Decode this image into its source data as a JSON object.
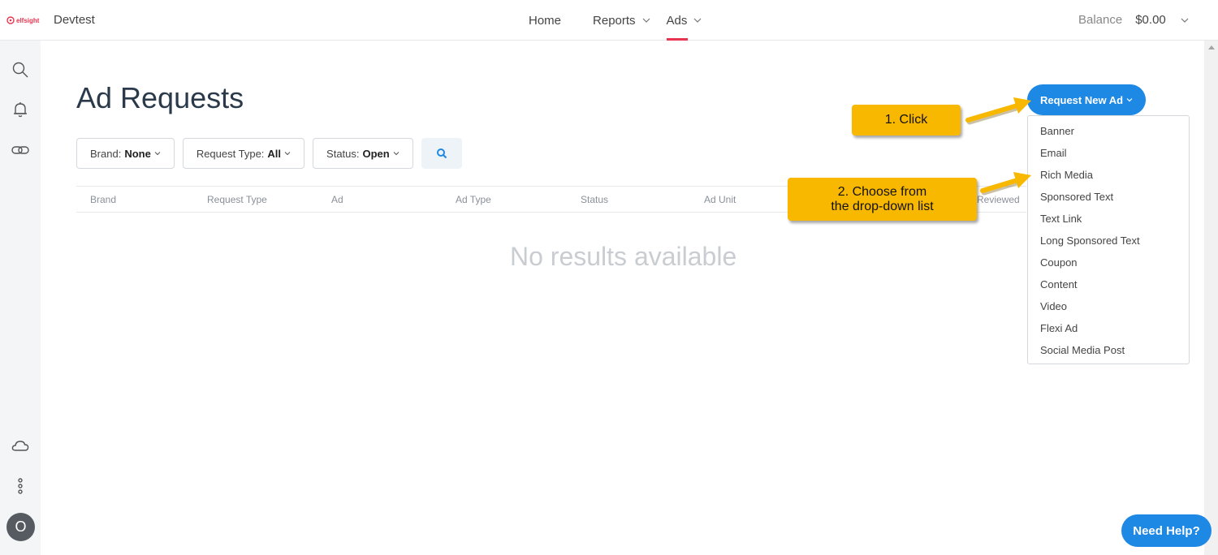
{
  "header": {
    "logo_text": "elfsight",
    "app_name": "Devtest",
    "nav": [
      {
        "label": "Home"
      },
      {
        "label": "Reports"
      },
      {
        "label": "Ads"
      }
    ],
    "balance_label": "Balance",
    "balance_amount": "$0.00"
  },
  "sidebar": {
    "icons": [
      "search-icon",
      "bell-icon",
      "link-icon",
      "cloud-icon",
      "more-vertical-icon"
    ],
    "avatar_initial": "O"
  },
  "main": {
    "title": "Ad Requests",
    "filters": [
      {
        "label": "Brand:",
        "value": "None"
      },
      {
        "label": "Request Type:",
        "value": "All"
      },
      {
        "label": "Status:",
        "value": "Open"
      }
    ],
    "columns": [
      "Brand",
      "Request Type",
      "Ad",
      "Ad Type",
      "Status",
      "Ad Unit",
      "Reviewed"
    ],
    "empty_text": "No results available"
  },
  "request_button": {
    "label": "Request New Ad",
    "options": [
      "Banner",
      "Email",
      "Rich Media",
      "Sponsored Text",
      "Text Link",
      "Long Sponsored Text",
      "Coupon",
      "Content",
      "Video",
      "Flexi Ad",
      "Social Media Post"
    ]
  },
  "callouts": {
    "first": "1. Click",
    "second_line1": "2. Choose from",
    "second_line2": "the drop-down list"
  },
  "help_button": "Need Help?",
  "colors": {
    "primary": "#1e88e5",
    "accent": "#e8344e",
    "callout": "#f9b800"
  }
}
